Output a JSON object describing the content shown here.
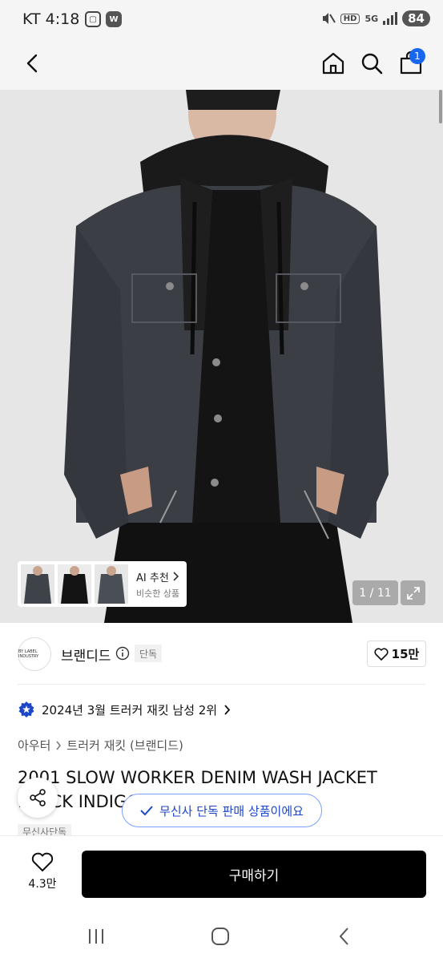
{
  "status_bar": {
    "carrier_time": "KT 4:18",
    "left_icon_badge": "W",
    "hd_label": "HD",
    "network_label": "5G",
    "battery": "84"
  },
  "header": {
    "icons": [
      "back-icon",
      "home-icon",
      "search-icon",
      "cart-icon"
    ],
    "cart_count": "1"
  },
  "gallery": {
    "counter": "1 / 11",
    "ai_title": "AI 추천",
    "ai_subtitle": "비슷한 상품"
  },
  "brand": {
    "logo_text": "BY LABEL INDUSTRY",
    "name": "브랜디드",
    "badge": "단독",
    "likes": "15만"
  },
  "ranking": {
    "text": "2024년 3월 트러커 재킷 남성 2위"
  },
  "category": {
    "parent": "아우터",
    "child": "트러커 재킷 (브랜디드)"
  },
  "product": {
    "title_line1": "2001 SLOW WORKER DENIM WASH JACKET",
    "title_line2": "BLACK INDIGO",
    "exclusive_tag": "무신사단독"
  },
  "toast": {
    "text": "무신사 단독 판매 상품이에요"
  },
  "buy_bar": {
    "wish_count": "4.3만",
    "buy_label": "구매하기"
  },
  "colors": {
    "accent_blue": "#1866f0",
    "toast_text": "#1c47c9",
    "buy_button": "#000000"
  }
}
